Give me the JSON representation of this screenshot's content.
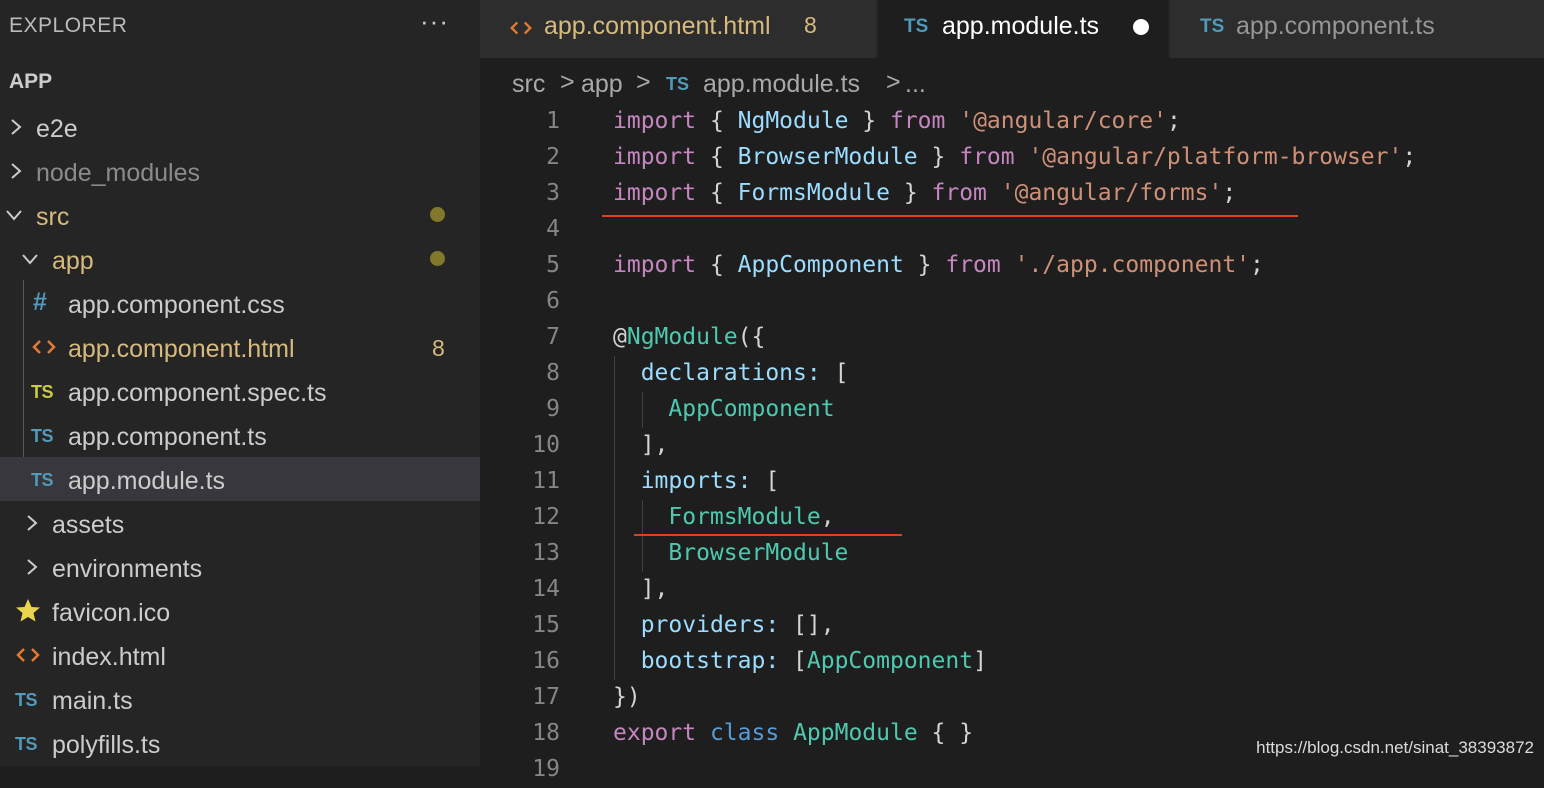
{
  "sidebar": {
    "title": "EXPLORER",
    "more_label": "···",
    "project": "APP",
    "items": [
      {
        "label": "e2e"
      },
      {
        "label": "node_modules"
      },
      {
        "label": "src"
      },
      {
        "label": "app"
      },
      {
        "label": "app.component.css"
      },
      {
        "label": "app.component.html",
        "badge": "8"
      },
      {
        "label": "app.component.spec.ts"
      },
      {
        "label": "app.component.ts"
      },
      {
        "label": "app.module.ts"
      },
      {
        "label": "assets"
      },
      {
        "label": "environments"
      },
      {
        "label": "favicon.ico"
      },
      {
        "label": "index.html"
      },
      {
        "label": "main.ts"
      },
      {
        "label": "polyfills.ts"
      }
    ]
  },
  "tabs": [
    {
      "label": "app.component.html",
      "badge": "8"
    },
    {
      "label": "app.module.ts",
      "icon": "TS"
    },
    {
      "label": "app.component.ts",
      "icon": "TS"
    }
  ],
  "breadcrumb": {
    "parts": [
      "src",
      "app",
      "app.module.ts",
      "..."
    ],
    "file_icon": "TS",
    "sep": ">"
  },
  "editor": {
    "lines": [
      {
        "n": "1",
        "parts": [
          [
            "k",
            "import"
          ],
          [
            "p",
            " { "
          ],
          [
            "v",
            "NgModule"
          ],
          [
            "p",
            " } "
          ],
          [
            "k",
            "from"
          ],
          [
            "p",
            " "
          ],
          [
            "s",
            "'@angular/core'"
          ],
          [
            "p",
            ";"
          ]
        ]
      },
      {
        "n": "2",
        "parts": [
          [
            "k",
            "import"
          ],
          [
            "p",
            " { "
          ],
          [
            "v",
            "BrowserModule"
          ],
          [
            "p",
            " } "
          ],
          [
            "k",
            "from"
          ],
          [
            "p",
            " "
          ],
          [
            "s",
            "'@angular/platform-browser'"
          ],
          [
            "p",
            ";"
          ]
        ]
      },
      {
        "n": "3",
        "parts": [
          [
            "k",
            "import"
          ],
          [
            "p",
            " { "
          ],
          [
            "v",
            "FormsModule"
          ],
          [
            "p",
            " } "
          ],
          [
            "k",
            "from"
          ],
          [
            "p",
            " "
          ],
          [
            "s",
            "'@angular/forms'"
          ],
          [
            "p",
            ";"
          ]
        ]
      },
      {
        "n": "4",
        "parts": []
      },
      {
        "n": "5",
        "parts": [
          [
            "k",
            "import"
          ],
          [
            "p",
            " { "
          ],
          [
            "v",
            "AppComponent"
          ],
          [
            "p",
            " } "
          ],
          [
            "k",
            "from"
          ],
          [
            "p",
            " "
          ],
          [
            "s",
            "'./app.component'"
          ],
          [
            "p",
            ";"
          ]
        ]
      },
      {
        "n": "6",
        "parts": []
      },
      {
        "n": "7",
        "parts": [
          [
            "p",
            "@"
          ],
          [
            "t",
            "NgModule"
          ],
          [
            "p",
            "({"
          ]
        ]
      },
      {
        "n": "8",
        "parts": [
          [
            "p",
            "  "
          ],
          [
            "v",
            "declarations"
          ],
          [
            "v",
            ":"
          ],
          [
            "p",
            " ["
          ]
        ]
      },
      {
        "n": "9",
        "parts": [
          [
            "p",
            "    "
          ],
          [
            "t",
            "AppComponent"
          ]
        ]
      },
      {
        "n": "10",
        "parts": [
          [
            "p",
            "  ],"
          ]
        ]
      },
      {
        "n": "11",
        "parts": [
          [
            "p",
            "  "
          ],
          [
            "v",
            "imports"
          ],
          [
            "v",
            ":"
          ],
          [
            "p",
            " ["
          ]
        ]
      },
      {
        "n": "12",
        "parts": [
          [
            "p",
            "    "
          ],
          [
            "t",
            "FormsModule"
          ],
          [
            "p",
            ","
          ]
        ]
      },
      {
        "n": "13",
        "parts": [
          [
            "p",
            "    "
          ],
          [
            "t",
            "BrowserModule"
          ]
        ]
      },
      {
        "n": "14",
        "parts": [
          [
            "p",
            "  ],"
          ]
        ]
      },
      {
        "n": "15",
        "parts": [
          [
            "p",
            "  "
          ],
          [
            "v",
            "providers"
          ],
          [
            "v",
            ":"
          ],
          [
            "p",
            " [],"
          ]
        ]
      },
      {
        "n": "16",
        "parts": [
          [
            "p",
            "  "
          ],
          [
            "v",
            "bootstrap"
          ],
          [
            "v",
            ":"
          ],
          [
            "p",
            " ["
          ],
          [
            "t",
            "AppComponent"
          ],
          [
            "p",
            "]"
          ]
        ]
      },
      {
        "n": "17",
        "parts": [
          [
            "p",
            "})"
          ]
        ]
      },
      {
        "n": "18",
        "parts": [
          [
            "k",
            "export"
          ],
          [
            "p",
            " "
          ],
          [
            "kb",
            "class"
          ],
          [
            "p",
            " "
          ],
          [
            "t",
            "AppModule"
          ],
          [
            "p",
            " { }"
          ]
        ]
      },
      {
        "n": "19",
        "parts": []
      }
    ]
  },
  "watermark": "https://blog.csdn.net/sinat_38393872",
  "colors": {
    "keyword": "#c586c0",
    "variable": "#9cdcfe",
    "string": "#ce9178",
    "type": "#4ec9b0",
    "underline": "#e0401f"
  }
}
